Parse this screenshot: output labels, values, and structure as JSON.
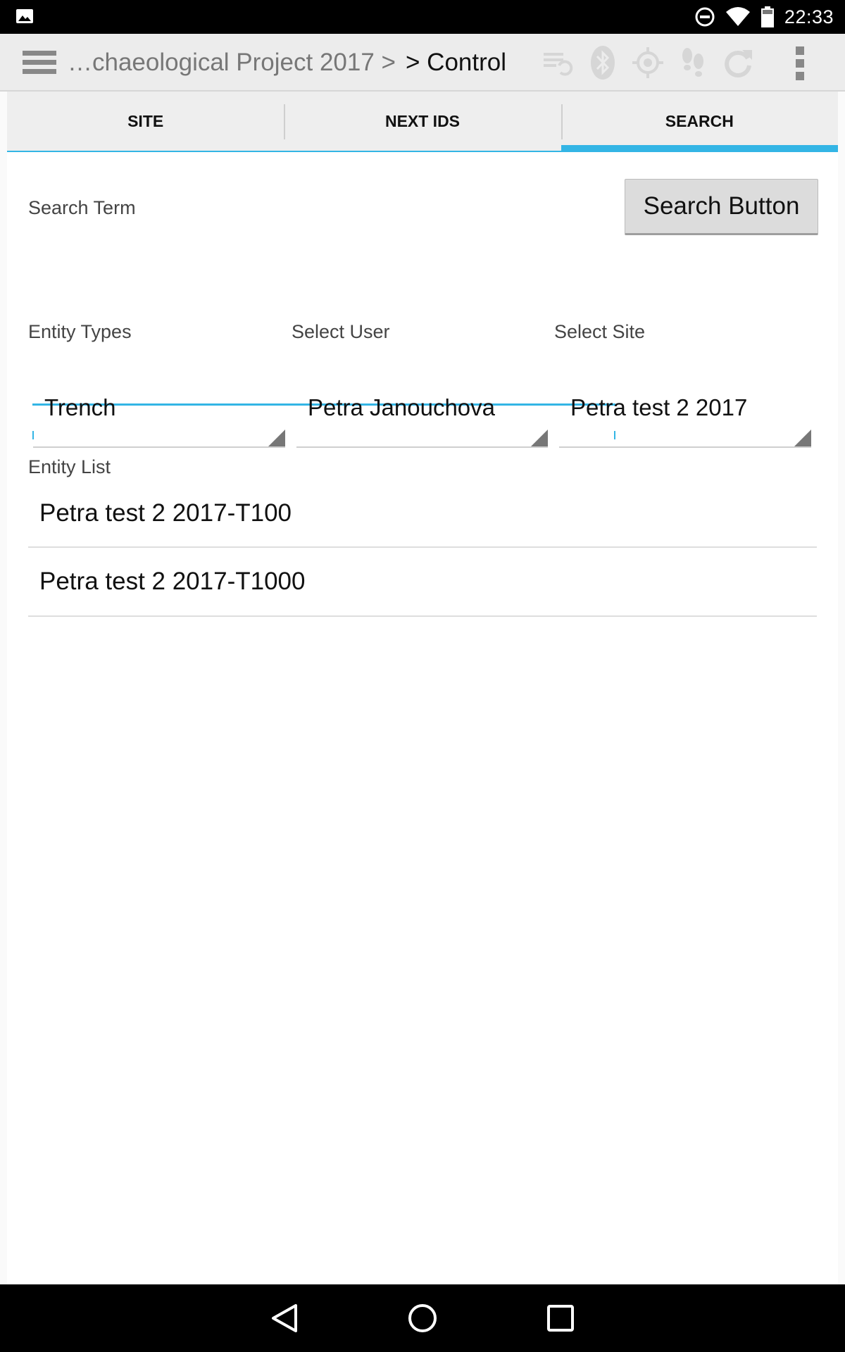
{
  "status_bar": {
    "time": "22:33",
    "icons": [
      "image-notification-icon",
      "do-not-disturb-icon",
      "wifi-icon",
      "battery-icon"
    ]
  },
  "action_bar": {
    "breadcrumb_parent": "…chaeological Project 2017 >",
    "breadcrumb_current": "> Control",
    "icons": [
      "sync-status-icon",
      "bluetooth-icon",
      "gps-icon",
      "tracking-icon",
      "refresh-icon"
    ],
    "menu_icon": "hamburger-menu-icon",
    "overflow_icon": "overflow-menu-icon"
  },
  "tabs": [
    {
      "label": "SITE",
      "active": false
    },
    {
      "label": "NEXT IDS",
      "active": false
    },
    {
      "label": "SEARCH",
      "active": true
    }
  ],
  "search": {
    "term_label": "Search Term",
    "term_value": "",
    "button_label": "Search Button"
  },
  "filters": {
    "entity_types": {
      "label": "Entity Types",
      "value": "Trench"
    },
    "user": {
      "label": "Select User",
      "value": "Petra Janouchova"
    },
    "site": {
      "label": "Select Site",
      "value": "Petra test 2 2017"
    }
  },
  "entity_list": {
    "label": "Entity List",
    "items": [
      "Petra test 2 2017-T100",
      "Petra test 2 2017-T1000"
    ]
  },
  "nav_bar": {
    "icons": [
      "back-icon",
      "home-icon",
      "recents-icon"
    ]
  },
  "colors": {
    "accent": "#33b5e5",
    "action_bar": "#ececec",
    "status_bar": "#000000"
  }
}
